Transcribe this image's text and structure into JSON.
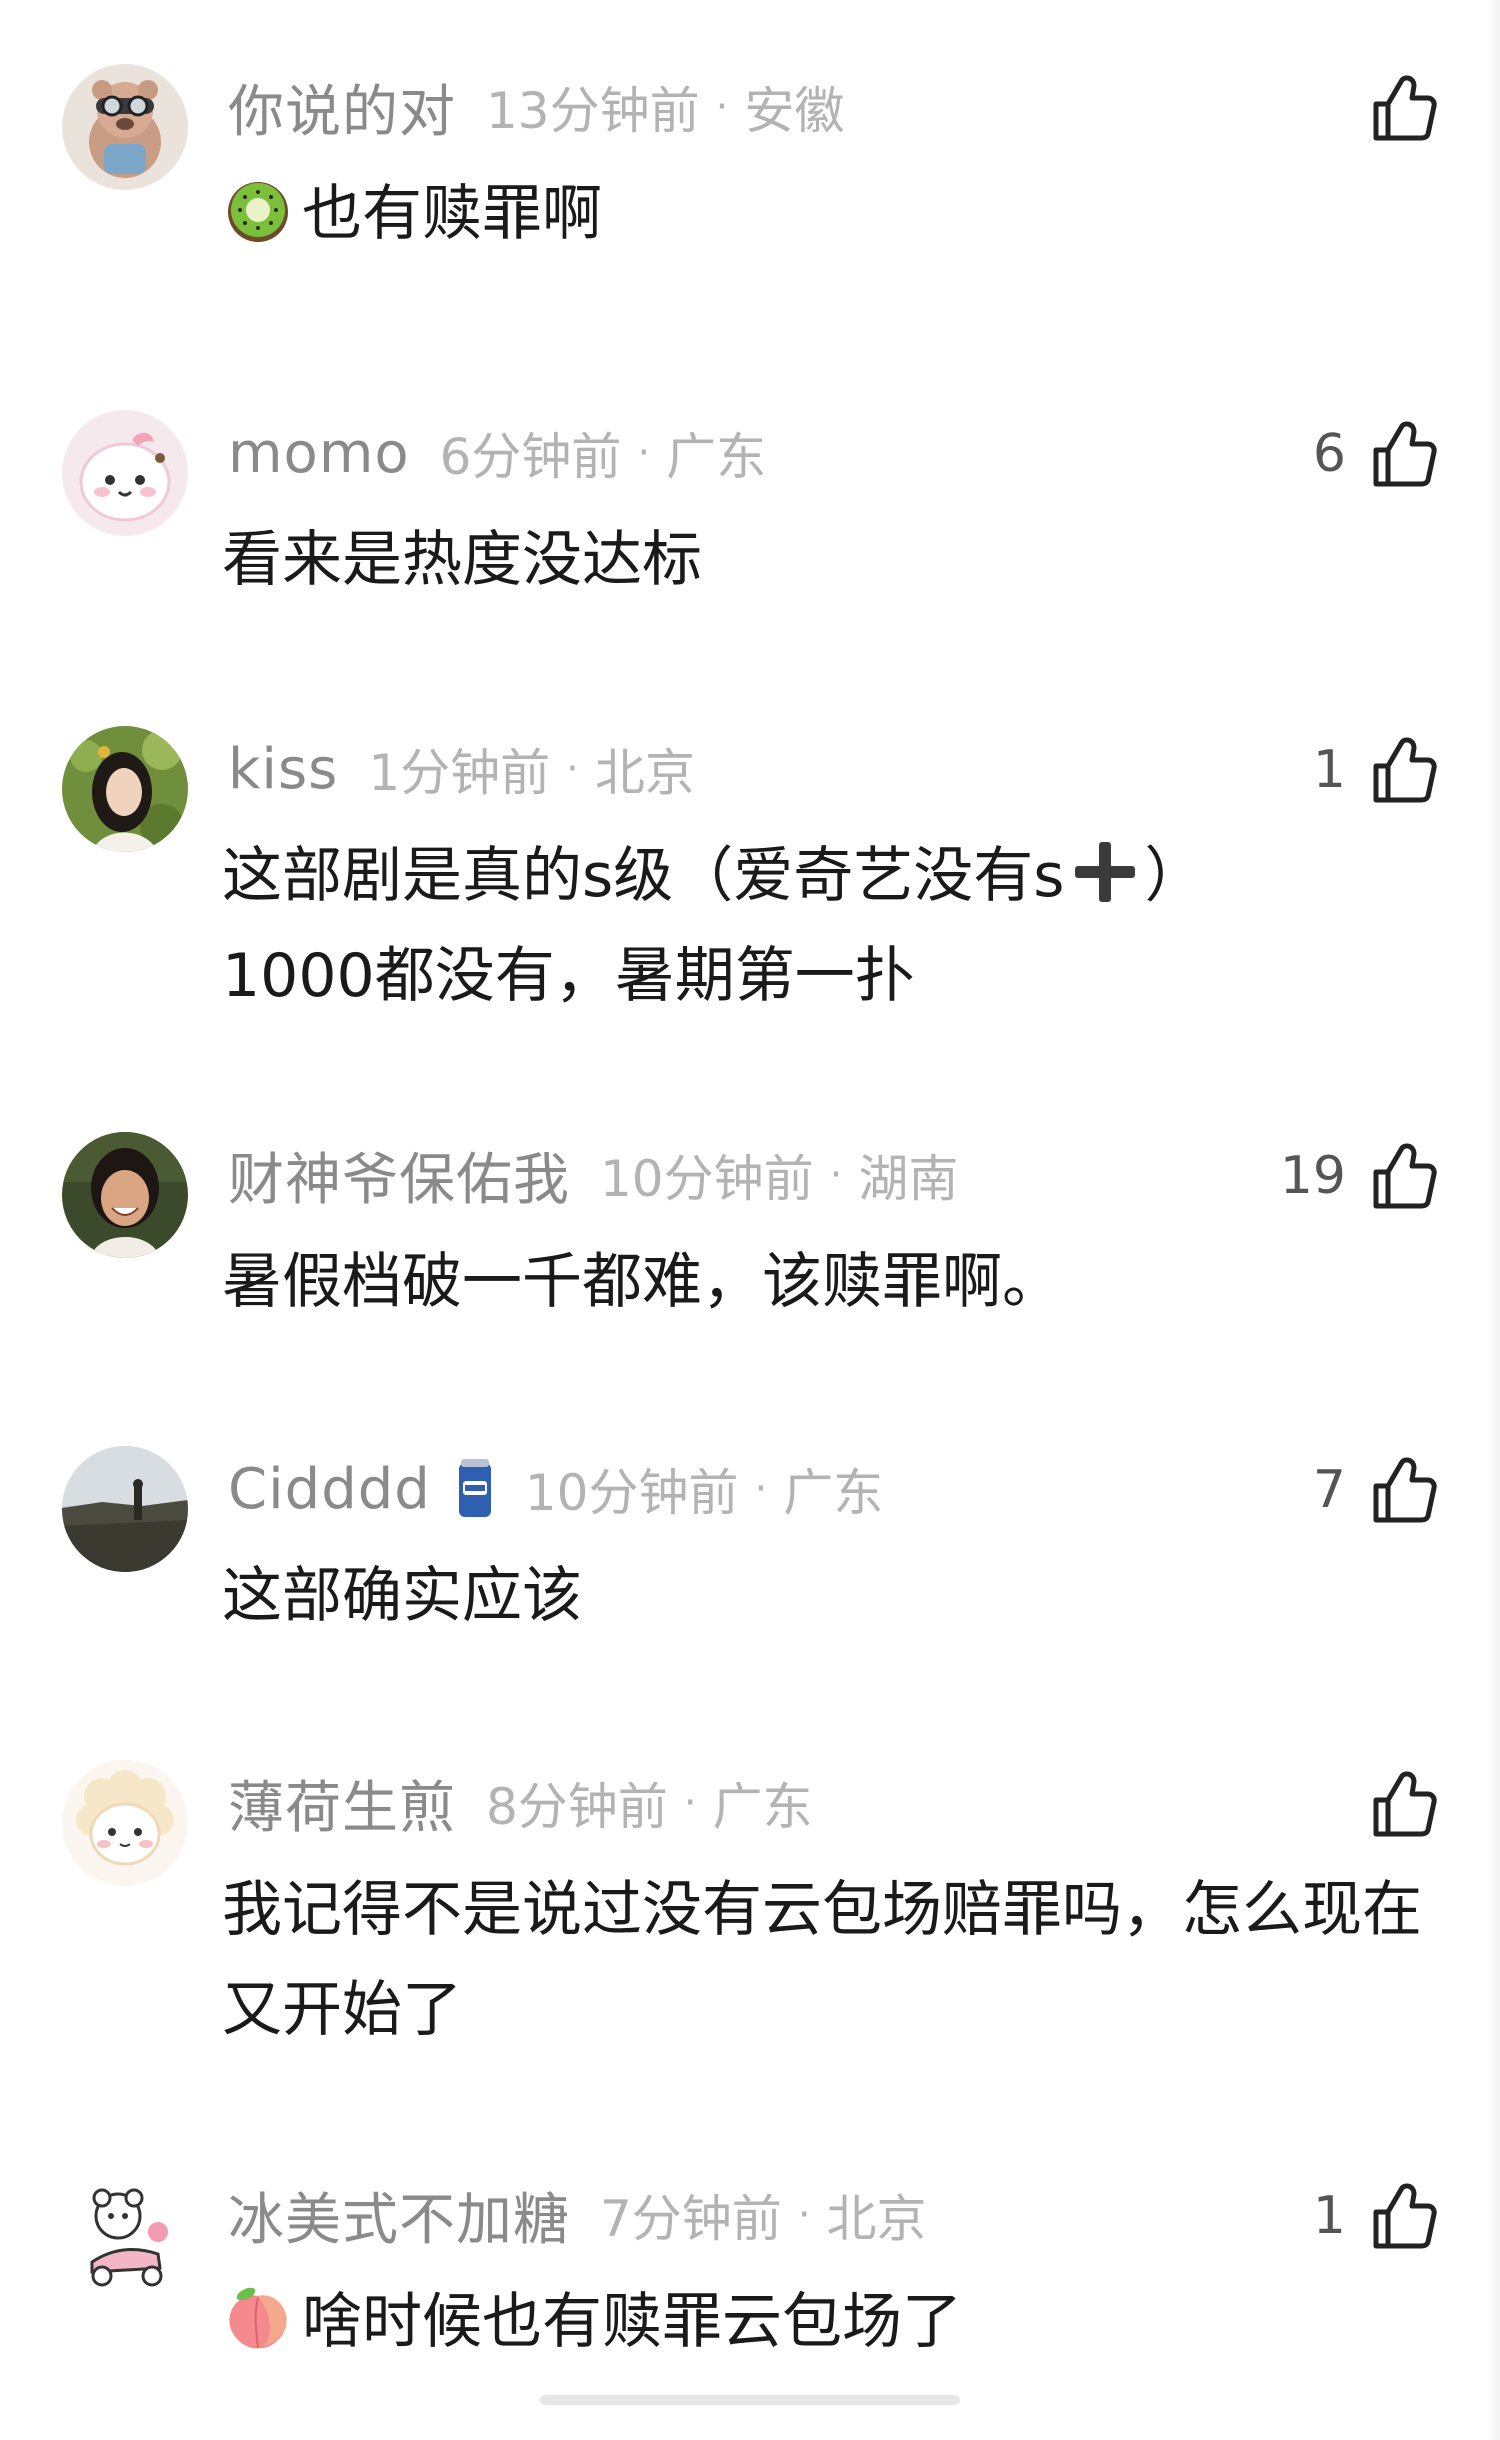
{
  "comments": [
    {
      "username": "你说的对",
      "time": "13分钟前",
      "location": "安徽",
      "likes": "",
      "text": "也有赎罪啊",
      "prefix_emoji": "kiwi-fruit-emoji"
    },
    {
      "username": "momo",
      "time": "6分钟前",
      "location": "广东",
      "likes": "6",
      "text": "看来是热度没达标"
    },
    {
      "username": "kiss",
      "time": "1分钟前",
      "location": "北京",
      "likes": "1",
      "text_part1": "这部剧是真的s级（爱奇艺没有s",
      "text_part2": "）",
      "text_part3": "1000都没有，暑期第一扑",
      "inline_emoji": "heavy-plus-emoji"
    },
    {
      "username": "财神爷保佑我",
      "time": "10分钟前",
      "location": "湖南",
      "likes": "19",
      "text": "暑假档破一千都难，该赎罪啊。"
    },
    {
      "username": "Cidddd",
      "time": "10分钟前",
      "location": "广东",
      "likes": "7",
      "text": "这部确实应该",
      "badge": "can-badge-icon"
    },
    {
      "username": "薄荷生煎",
      "time": "8分钟前",
      "location": "广东",
      "likes": "",
      "text": "我记得不是说过没有云包场赔罪吗，怎么现在又开始了"
    },
    {
      "username": "冰美式不加糖",
      "time": "7分钟前",
      "location": "北京",
      "likes": "1",
      "text": "啥时候也有赎罪云包场了",
      "prefix_emoji": "peach-emoji"
    }
  ],
  "separator": "·",
  "colors": {
    "username": "#8a8a8a",
    "meta": "#b3b3b3",
    "text": "#1a1a1a",
    "like_icon": "#222222"
  }
}
